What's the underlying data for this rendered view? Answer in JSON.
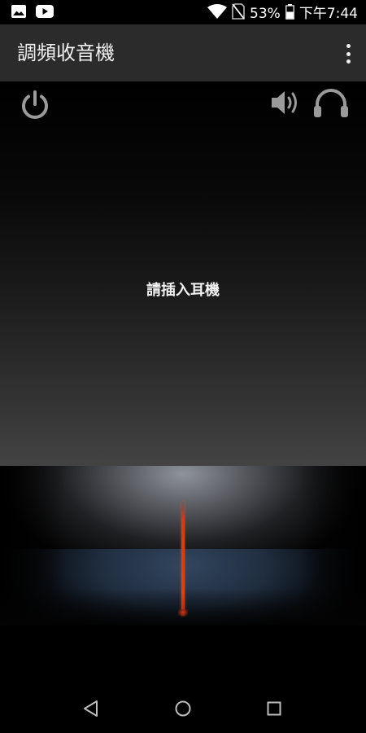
{
  "status_bar": {
    "left_icons": [
      "image-icon",
      "youtube-icon"
    ],
    "right_icons": [
      "wifi-icon",
      "no-sim-icon",
      "battery-icon"
    ],
    "battery_percent": "53%",
    "time": "下午7:44"
  },
  "app_bar": {
    "title": "調頻收音機",
    "overflow_icon": "more-vertical-icon"
  },
  "controls": {
    "power_icon": "power-icon",
    "speaker_icon": "speaker-icon",
    "headphone_icon": "headphone-icon"
  },
  "main": {
    "message": "請插入耳機"
  },
  "tuner": {
    "needle_color": "#d2451f"
  },
  "nav_bar": {
    "icons": [
      "back-icon",
      "home-icon",
      "recents-icon"
    ]
  },
  "colors": {
    "app_bar_bg": "#2b2b2b",
    "icon_gray": "#9a9a9a",
    "text": "#f1f1f1"
  }
}
